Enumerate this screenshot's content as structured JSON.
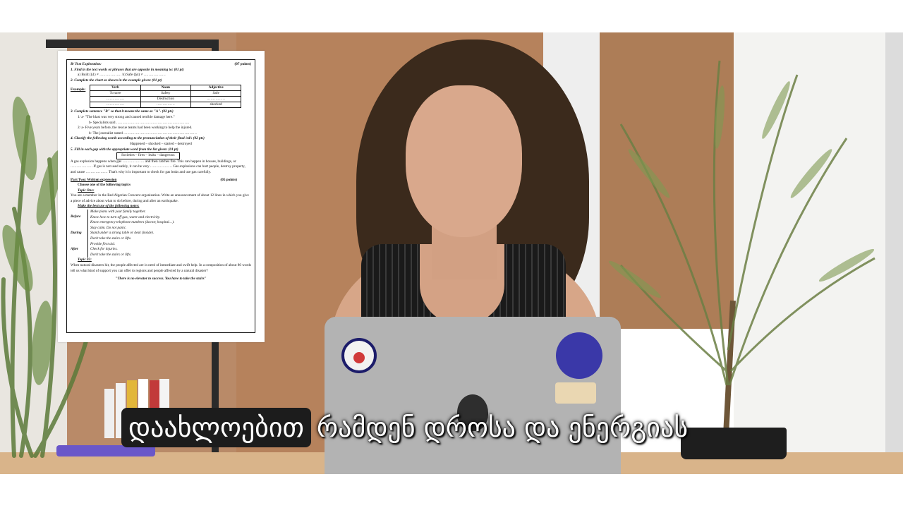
{
  "caption": {
    "highlighted": "დაახლოებით",
    "rest": "რამდენ დროსა და ენერგიას"
  },
  "document": {
    "section_title": "B/ Text Exploration:",
    "section_points": "(07 points)",
    "q1": "1.   Find in the text words or phrases that are opposite in meaning to: (01 pt)",
    "q1_items": "a) Built (§1) ≠ ………………        b) Safe (§4) ≠ ………………",
    "q2": "2.  Complete the chart as shown in the example given: (01 pt)",
    "q2_example": "Example:",
    "table_headers": [
      "Verb",
      "Noun",
      "Adjective"
    ],
    "table_rows": [
      [
        "To save",
        "Safety",
        "Safe"
      ],
      [
        "……………",
        "Destruction",
        "……………"
      ],
      [
        "……………",
        "……………",
        "shocked"
      ]
    ],
    "q3": "3.  Complete sentence \"B\" so that it means the same as \"A\". (02 pts)",
    "q3_1a": "1/  a- \"The blast was very strong and caused terrible damage here.\"",
    "q3_1b": "b- Specialists said ……………………………………………………",
    "q3_2a": "2/  a- Five years before, the rescue teams had been working to help the injured.",
    "q3_2b": "b- The journalist stated ……………………………………………………",
    "q4": "4.  Classify the following words according to the pronunciation of their final /ed/: (02 pts)",
    "q4_words": "Happened – shocked – started – destroyed",
    "q5": "5.  Fill in each gap with the appropriate word from the list given: (01 pt)",
    "q5_box": "Societies – fires – leaks – dangerous",
    "q5_text": "A gas explosion happens when gas ……………… and then catches fire. This can happen in houses, buildings, or ……………… If gas is not used safely, it can be very ……………… Gas explosions can hurt people, destroy property, and cause ……………… That's why it is important to check for gas leaks and use gas carefully.",
    "part_two": "Part Two: Written expression",
    "part_two_points": "(05 points)",
    "choose": "Choose one of the following topics",
    "topic_one": "Topic One:",
    "topic_one_text": "You are a member in the Red Algerian Crescent organization. Write an announcement of about 12 lines in which you give a piece of advice about what to do before, during and after an earthquake.",
    "notes_title": "Make the best use of the following notes:",
    "before_label": "Before",
    "before_notes": [
      "Make plans with your family together.",
      "Know how to turn off gas, water and electricity.",
      "Know emergency telephone numbers (doctor, hospital…)."
    ],
    "during_label": "During",
    "during_notes": [
      "Stay calm. Do not panic.",
      "Stand under a strong table or desk (inside).",
      "Don't take the stairs or lifts."
    ],
    "after_label": "After",
    "after_notes": [
      "Provide first aid.",
      "Check for injuries.",
      "Don't take the stairs or lifts."
    ],
    "topic_two": "Topic 02:",
    "topic_two_text": "When natural disasters hit, the people affected are in need of immediate and swift help. In a composition of about 80 words tell us what kind of support you can offer to regions and people affected by a natural disaster?",
    "quote": "\"There is no elevator to success. You have to take the stairs\""
  }
}
